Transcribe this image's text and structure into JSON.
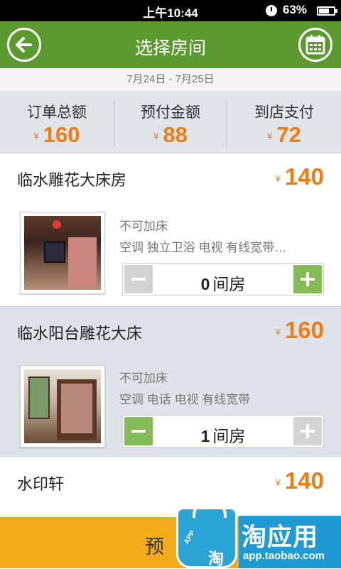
{
  "status_bar": {
    "time": "上午10:44",
    "battery": "63%"
  },
  "header": {
    "title": "选择房间",
    "back_icon": "back-arrow-icon",
    "calendar_icon": "calendar-icon"
  },
  "date_range": "7月24日 - 7月25日",
  "summary": {
    "currency": "¥",
    "items": [
      {
        "label": "订单总额",
        "value": "160"
      },
      {
        "label": "预付金额",
        "value": "88"
      },
      {
        "label": "到店支付",
        "value": "72"
      }
    ]
  },
  "rooms": [
    {
      "name": "临水雕花大床房",
      "price": "140",
      "note": "不可加床",
      "amenities": "空调 独立卫浴 电视 有线宽带…",
      "count": "0",
      "unit": "间房",
      "minus_enabled": false,
      "plus_enabled": true
    },
    {
      "name": "临水阳台雕花大床",
      "price": "160",
      "note": "不可加床",
      "amenities": "空调 电话 电视 有线宽带",
      "count": "1",
      "unit": "间房",
      "minus_enabled": true,
      "plus_enabled": false
    },
    {
      "name": "水印轩",
      "price": "140"
    }
  ],
  "bottom_bar": {
    "label": "预"
  },
  "watermark": {
    "title": "淘应用",
    "url": "app.taobao.com",
    "bag_tag": "APP",
    "bag_glyph": "淘"
  },
  "colors": {
    "brand_green": "#5a9a2e",
    "price_orange": "#ef7d11",
    "stepper_green": "#84bb54",
    "bottom_orange": "#f3aa1b",
    "watermark_blue": "#1f9ad2"
  }
}
